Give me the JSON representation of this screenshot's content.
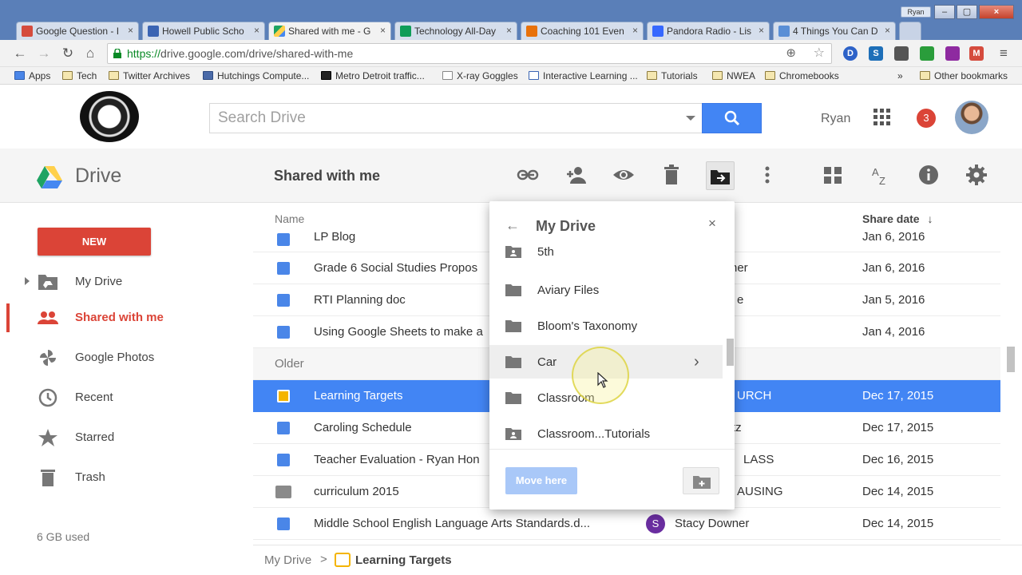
{
  "browser": {
    "tabs": [
      {
        "label": "Google Question - I",
        "favicon_color": "#d54b3d"
      },
      {
        "label": "Howell Public Scho",
        "favicon_color": "#3a64b3"
      },
      {
        "label": "Shared with me - G",
        "favicon_color": "#1fa463"
      },
      {
        "label": "Technology All-Day",
        "favicon_color": "#0f9d58"
      },
      {
        "label": "Coaching 101 Even",
        "favicon_color": "#e8710a"
      },
      {
        "label": "Pandora Radio - Lis",
        "favicon_color": "#3668ff"
      },
      {
        "label": "4 Things You Can D",
        "favicon_color": "#5a8fd6"
      }
    ],
    "user_chip": "Ryan",
    "url_scheme": "https://",
    "url_rest": "drive.google.com/drive/shared-with-me",
    "bookmarks": [
      {
        "label": "Apps"
      },
      {
        "label": "Tech"
      },
      {
        "label": "Twitter Archives"
      },
      {
        "label": "Hutchings Compute..."
      },
      {
        "label": "Metro Detroit traffic..."
      },
      {
        "label": "X-ray Goggles"
      },
      {
        "label": "Interactive Learning ..."
      },
      {
        "label": "Tutorials"
      },
      {
        "label": "NWEA"
      },
      {
        "label": "Chromebooks"
      },
      {
        "label": "Other bookmarks"
      }
    ],
    "bookmarks_overflow": "»",
    "extensions": [
      "D",
      "S",
      "",
      "",
      "",
      "M"
    ]
  },
  "header": {
    "search_placeholder": "Search Drive",
    "user_name": "Ryan",
    "notification_count": "3"
  },
  "action_bar": {
    "brand": "Drive",
    "view_title": "Shared with me"
  },
  "sidebar": {
    "new_label": "NEW",
    "items": [
      {
        "label": "My Drive"
      },
      {
        "label": "Shared with me"
      },
      {
        "label": "Google Photos"
      },
      {
        "label": "Recent"
      },
      {
        "label": "Starred"
      },
      {
        "label": "Trash"
      }
    ],
    "storage": "6 GB used"
  },
  "file_list": {
    "col_name": "Name",
    "col_share_date": "Share date",
    "rows": [
      {
        "name": "LP Blog",
        "owner": "",
        "date": "Jan 6, 2016",
        "type": "doc"
      },
      {
        "name": "Grade 6 Social Studies Propos",
        "owner": "ner",
        "date": "Jan 6, 2016",
        "type": "doc"
      },
      {
        "name": "RTI Planning doc",
        "owner": "e",
        "date": "Jan 5, 2016",
        "type": "doc"
      },
      {
        "name": "Using Google Sheets to make a",
        "owner": "",
        "date": "Jan 4, 2016",
        "type": "doc"
      },
      {
        "name": "Older",
        "owner": "",
        "date": "",
        "type": "section"
      },
      {
        "name": "Learning Targets",
        "owner": "URCH",
        "date": "Dec 17, 2015",
        "type": "slides"
      },
      {
        "name": "Caroling Schedule",
        "owner": "tz",
        "date": "Dec 17, 2015",
        "type": "doc"
      },
      {
        "name": "Teacher Evaluation - Ryan Hon",
        "owner": "LASS",
        "date": "Dec 16, 2015",
        "type": "doc"
      },
      {
        "name": "curriculum 2015",
        "owner": "AUSING",
        "date": "Dec 14, 2015",
        "type": "shared-folder"
      },
      {
        "name": "Middle School English Language Arts Standards.d...",
        "owner": "Stacy Downer",
        "owner_initial": "S",
        "date": "Dec 14, 2015",
        "type": "doc"
      }
    ]
  },
  "breadcrumb": {
    "root": "My Drive",
    "separator": ">",
    "current": "Learning Targets"
  },
  "move_dialog": {
    "back_icon": "←",
    "title": "My Drive",
    "close_icon": "×",
    "folders": [
      {
        "label": "5th",
        "type": "shared-folder"
      },
      {
        "label": "Aviary Files",
        "type": "folder"
      },
      {
        "label": "Bloom's Taxonomy",
        "type": "folder"
      },
      {
        "label": "Car",
        "type": "folder",
        "has_children": true
      },
      {
        "label": "Classroom",
        "type": "folder"
      },
      {
        "label": "Classroom...Tutorials",
        "type": "shared-folder"
      }
    ],
    "chevron": "›",
    "move_here_label": "Move here"
  },
  "colors": {
    "accent_red": "#db4437",
    "accent_blue": "#4285f4",
    "slides_yellow": "#f4b400",
    "doc_blue": "#4a86e8"
  }
}
